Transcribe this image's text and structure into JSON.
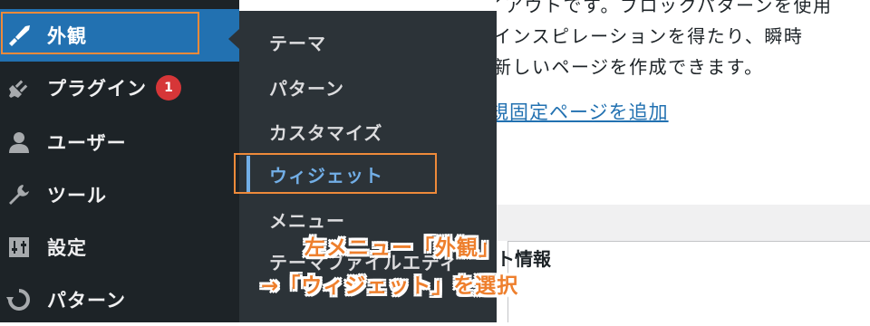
{
  "sidebar": {
    "items": [
      {
        "label": "外観",
        "icon": "paintbrush-icon",
        "current": true
      },
      {
        "label": "プラグイン",
        "icon": "plugin-icon",
        "badge": "1"
      },
      {
        "label": "ユーザー",
        "icon": "user-icon"
      },
      {
        "label": "ツール",
        "icon": "wrench-icon"
      },
      {
        "label": "設定",
        "icon": "settings-sliders-icon"
      },
      {
        "label": "パターン",
        "icon": "pattern-refresh-icon"
      }
    ]
  },
  "submenu": {
    "items": [
      {
        "label": "テーマ"
      },
      {
        "label": "パターン"
      },
      {
        "label": "カスタマイズ"
      },
      {
        "label": "ウィジェット",
        "active": true
      },
      {
        "label": "メニュー"
      },
      {
        "label": "テーマファイルエディ"
      }
    ]
  },
  "content": {
    "lines": [
      "レイアウトです。ブロックパターンを使用",
      "インスピレーションを得たり、瞬時",
      "新しいページを作成できます。"
    ],
    "link": "規固定ページを追加",
    "panel_title": "ト情報"
  },
  "annotation": {
    "line1": "左メニュー「外観」",
    "line2": "→「ウィジェット」を選択"
  },
  "colors": {
    "menu_bg": "#1d2327",
    "submenu_bg": "#2c3338",
    "accent": "#2271b1",
    "active_sub": "#72aee6",
    "badge": "#d63638",
    "highlight": "#ee8a3a"
  }
}
